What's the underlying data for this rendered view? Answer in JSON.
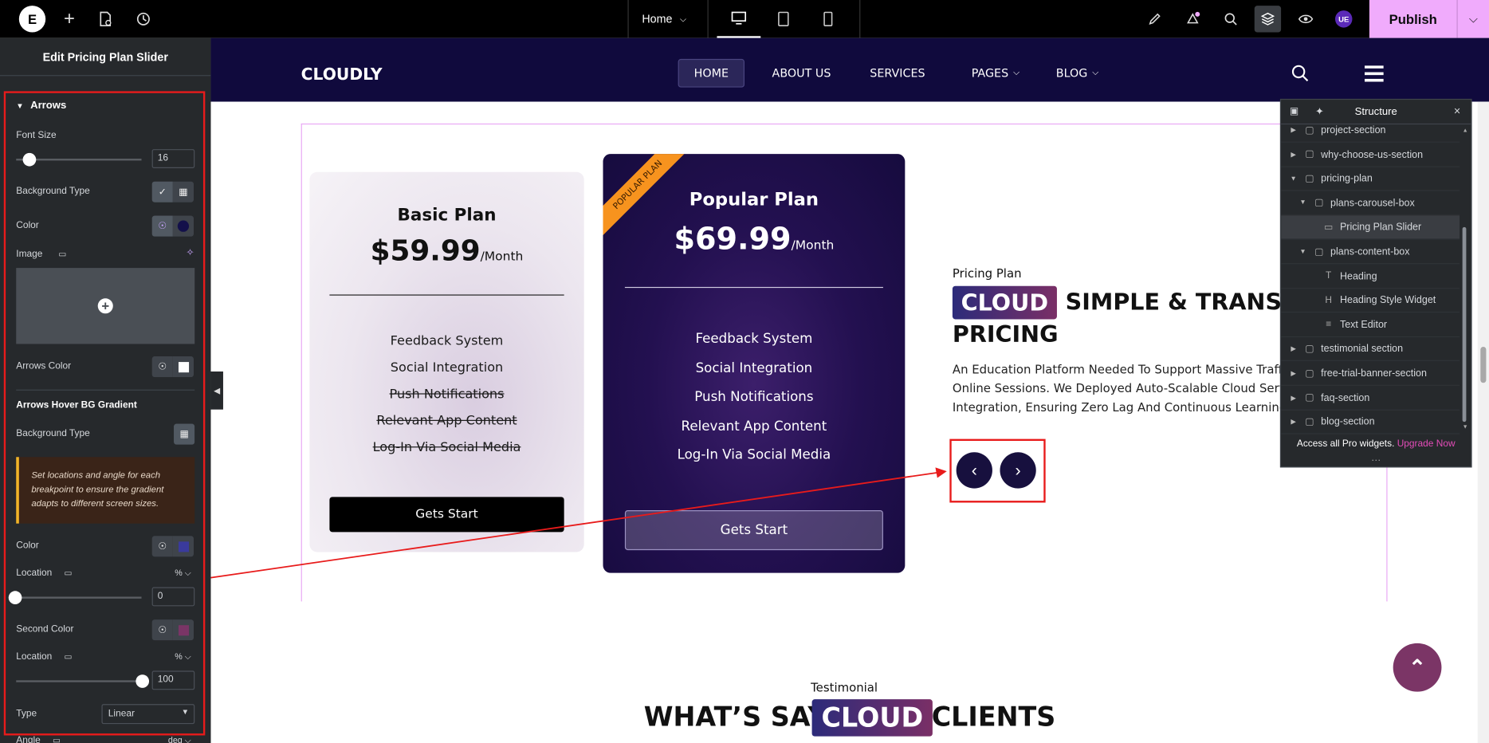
{
  "topbar": {
    "logo": "E",
    "page_select": "Home",
    "publish_label": "Publish",
    "user_initials": "UE"
  },
  "panel": {
    "title": "Edit Pricing Plan Slider",
    "section_title": "Arrows",
    "font_size_label": "Font Size",
    "font_size_value": "16",
    "bg_type_label": "Background Type",
    "color_label": "Color",
    "image_label": "Image",
    "arrows_color_label": "Arrows Color",
    "hover_heading": "Arrows Hover BG Gradient",
    "bg_type2_label": "Background Type",
    "notice": "Set locations and angle for each breakpoint to ensure the gradient adapts to different screen sizes.",
    "color2_label": "Color",
    "location_label": "Location",
    "location_unit": "%",
    "location_value": "0",
    "second_color_label": "Second Color",
    "location2_label": "Location",
    "location2_unit": "%",
    "location2_value": "100",
    "type_label": "Type",
    "type_value": "Linear",
    "angle_label": "Angle",
    "angle_unit": "deg",
    "colors": {
      "color_swatch": "#13104a",
      "gradient_color": "#3a3a9c",
      "second_color": "#7a3566",
      "arrows_color": "#ffffff"
    }
  },
  "site": {
    "brand": "CLOUDLY",
    "nav": [
      "HOME",
      "ABOUT US",
      "SERVICES",
      "PAGES",
      "BLOG"
    ],
    "basic_plan": {
      "name": "Basic Plan",
      "price": "$59.99",
      "period": "/Month",
      "features": [
        "Feedback System",
        "Social Integration",
        "Push Notifications",
        "Relevant App Content",
        "Log-In Via Social Media"
      ],
      "struck": [
        false,
        false,
        true,
        true,
        true
      ],
      "cta": "Gets Start"
    },
    "popular_plan": {
      "ribbon": "POPULAR PLAN",
      "name": "Popular Plan",
      "price": "$69.99",
      "period": "/Month",
      "features": [
        "Feedback System",
        "Social Integration",
        "Push Notifications",
        "Relevant App Content",
        "Log-In Via Social Media"
      ],
      "cta": "Gets Start"
    },
    "pricing_intro": {
      "kicker": "Pricing Plan",
      "highlight": "CLOUD",
      "title_rest": "SIMPLE & TRANSP",
      "title_line2": "PRICING",
      "body_lines": [
        "An Education Platform Needed To Support Massive Traffic",
        "Online Sessions. We Deployed Auto-Scalable Cloud Servers",
        "Integration, Ensuring Zero Lag And Continuous Learning Ex"
      ]
    },
    "testimonial": {
      "kicker": "Testimonial",
      "title_left": "WHAT’S SAY",
      "highlight": "CLOUD",
      "title_right": "CLIENTS"
    }
  },
  "structure": {
    "title": "Structure",
    "rows": [
      {
        "label": "project-section",
        "depth": 0,
        "caret": "▶"
      },
      {
        "label": "why-choose-us-section",
        "depth": 0,
        "caret": "▶"
      },
      {
        "label": "pricing-plan",
        "depth": 0,
        "caret": "▼"
      },
      {
        "label": "plans-carousel-box",
        "depth": 1,
        "caret": "▼"
      },
      {
        "label": "Pricing Plan Slider",
        "depth": 2,
        "caret": ""
      },
      {
        "label": "plans-content-box",
        "depth": 1,
        "caret": "▼"
      },
      {
        "label": "Heading",
        "depth": 2,
        "caret": ""
      },
      {
        "label": "Heading Style Widget",
        "depth": 2,
        "caret": ""
      },
      {
        "label": "Text Editor",
        "depth": 2,
        "caret": ""
      },
      {
        "label": "testimonial section",
        "depth": 0,
        "caret": "▶"
      },
      {
        "label": "free-trial-banner-section",
        "depth": 0,
        "caret": "▶"
      },
      {
        "label": "faq-section",
        "depth": 0,
        "caret": "▶"
      },
      {
        "label": "blog-section",
        "depth": 0,
        "caret": "▶"
      }
    ],
    "pro_text": "Access all Pro widgets.",
    "pro_link": "Upgrade Now"
  }
}
